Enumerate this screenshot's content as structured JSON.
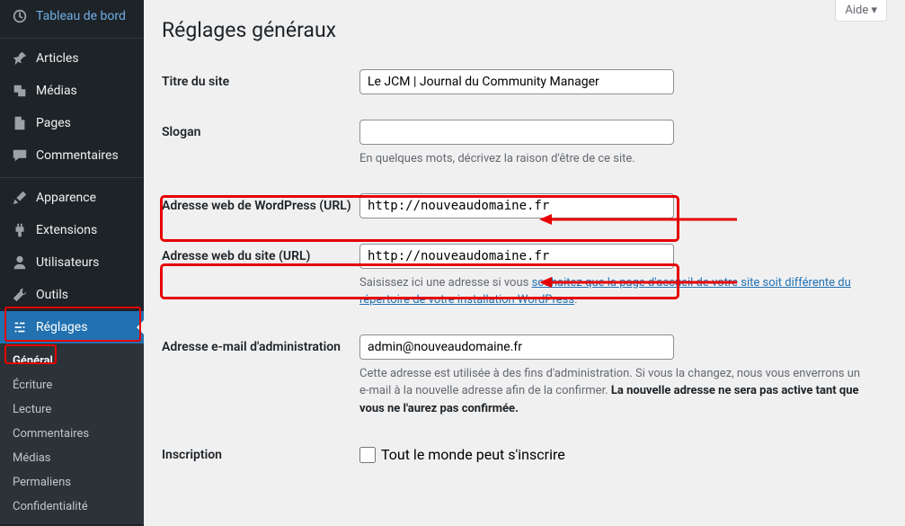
{
  "help": {
    "label": "Aide ▾"
  },
  "page": {
    "title": "Réglages généraux"
  },
  "sidebar": {
    "dashboard": "Tableau de bord",
    "articles": "Articles",
    "medias": "Médias",
    "pages": "Pages",
    "commentaires": "Commentaires",
    "apparence": "Apparence",
    "extensions": "Extensions",
    "utilisateurs": "Utilisateurs",
    "outils": "Outils",
    "reglages": "Réglages"
  },
  "submenu": {
    "general": "Général",
    "ecriture": "Écriture",
    "lecture": "Lecture",
    "commentaires": "Commentaires",
    "medias": "Médias",
    "permaliens": "Permaliens",
    "confidentialite": "Confidentialité"
  },
  "form": {
    "site_title_label": "Titre du site",
    "site_title_value": "Le JCM | Journal du Community Manager",
    "slogan_label": "Slogan",
    "slogan_value": "",
    "slogan_desc": "En quelques mots, décrivez la raison d'être de ce site.",
    "wp_url_label": "Adresse web de WordPress (URL)",
    "wp_url_value": "http://nouveaudomaine.fr",
    "site_url_label": "Adresse web du site (URL)",
    "site_url_value": "http://nouveaudomaine.fr",
    "site_url_desc_pre": "Saisissez ici une adresse si vous ",
    "site_url_desc_link": "souhaitez que la page d'accueil de votre site soit différente du répertoire de votre installation WordPress",
    "site_url_desc_post": ".",
    "admin_email_label": "Adresse e-mail d'administration",
    "admin_email_value": "admin@nouveaudomaine.fr",
    "admin_email_desc_pre": "Cette adresse est utilisée à des fins d'administration. Si vous la changez, nous vous enverrons un e-mail à la nouvelle adresse afin de la confirmer. ",
    "admin_email_desc_strong": "La nouvelle adresse ne sera pas active tant que vous ne l'aurez pas confirmée.",
    "inscription_label": "Inscription",
    "inscription_checkbox": "Tout le monde peut s'inscrire"
  }
}
